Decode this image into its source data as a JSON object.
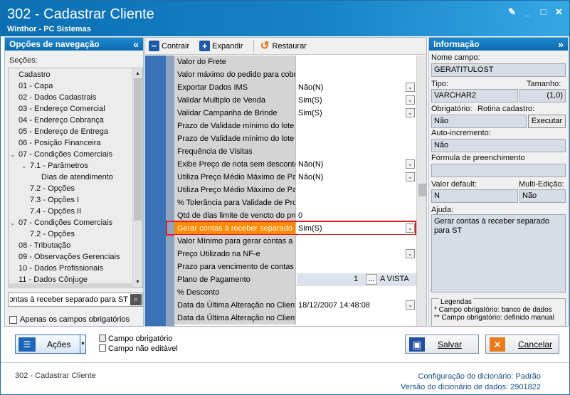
{
  "window": {
    "title": "302 - Cadastrar Cliente",
    "subtitle": "Winthor - PC Sistemas"
  },
  "nav": {
    "header": "Opções de navegação",
    "secoes_label": "Seções:",
    "items": [
      {
        "label": "Cadastro",
        "indent": 0,
        "chev": ""
      },
      {
        "label": "01 - Capa",
        "indent": 0,
        "chev": ""
      },
      {
        "label": "02 - Dados Cadastrais",
        "indent": 0,
        "chev": ""
      },
      {
        "label": "03 - Endereço Comercial",
        "indent": 0,
        "chev": ""
      },
      {
        "label": "04 - Endereço Cobrança",
        "indent": 0,
        "chev": ""
      },
      {
        "label": "05 - Endereço de Entrega",
        "indent": 0,
        "chev": ""
      },
      {
        "label": "06 - Posição Financeira",
        "indent": 0,
        "chev": ""
      },
      {
        "label": "07 - Condições Comerciais",
        "indent": 0,
        "chev": "v"
      },
      {
        "label": "7.1 - Parâmetros",
        "indent": 1,
        "chev": "v"
      },
      {
        "label": "Dias de atendimento",
        "indent": 2,
        "chev": ""
      },
      {
        "label": "7.2 - Opções",
        "indent": 1,
        "chev": ""
      },
      {
        "label": "7.3 - Opções I",
        "indent": 1,
        "chev": ""
      },
      {
        "label": "7.4 - Opções II",
        "indent": 1,
        "chev": ""
      },
      {
        "label": "07 - Condições Comerciais",
        "indent": 0,
        "chev": "v"
      },
      {
        "label": "7.2 - Opções",
        "indent": 1,
        "chev": ""
      },
      {
        "label": "08 - Tributação",
        "indent": 0,
        "chev": ""
      },
      {
        "label": "09 - Observações Gerenciais",
        "indent": 0,
        "chev": ""
      },
      {
        "label": "10 - Dados Profissionais",
        "indent": 0,
        "chev": ""
      },
      {
        "label": "11 - Dados Cônjuge",
        "indent": 0,
        "chev": ""
      }
    ],
    "search_value": "Gerar contas à receber separado para ST",
    "only_required_label": "Apenas os campos obrigatórios"
  },
  "toolbar": {
    "contrair": "Contrair",
    "expandir": "Expandir",
    "restaurar": "Restaurar"
  },
  "grid": {
    "rows": [
      {
        "label": "Valor do Frete",
        "value": "",
        "dropdown": false
      },
      {
        "label": "Valor máximo do pedido para cobrar",
        "value": "",
        "dropdown": false
      },
      {
        "label": "Exportar Dados IMS",
        "value": "Não(N)",
        "dropdown": true
      },
      {
        "label": "Validar Multiplo de Venda",
        "value": "Sim(S)",
        "dropdown": true
      },
      {
        "label": "Validar Campanha de Brinde",
        "value": "Sim(S)",
        "dropdown": true
      },
      {
        "label": "Prazo de Validade mínimo do lote / Produto",
        "value": "",
        "dropdown": false
      },
      {
        "label": "Prazo de Validade mínimo do lote / Cliente",
        "value": "",
        "dropdown": false
      },
      {
        "label": "Frequência de Visitas",
        "value": "",
        "dropdown": false
      },
      {
        "label": "Exibe Preço de nota sem desconto",
        "value": "Não(N)",
        "dropdown": true
      },
      {
        "label": "Utiliza Preço Médio Máximo de Pagamento",
        "value": "Não(N)",
        "dropdown": true
      },
      {
        "label": "Utiliza Preço Médio Máximo de Pagamento",
        "value": "",
        "dropdown": false
      },
      {
        "label": "% Tolerância para Validade de Produto",
        "value": "",
        "dropdown": false
      },
      {
        "label": "Qtd de dias limite de vencto do produto",
        "value": "0",
        "dropdown": false
      },
      {
        "label": "Gerar contas à receber separado para ST",
        "value": "Sim(S)",
        "dropdown": true,
        "selected": true
      },
      {
        "label": "Valor Mínimo para gerar contas a receber",
        "value": "",
        "dropdown": false
      },
      {
        "label": "Preço Utilizado na NF-e",
        "value": "",
        "dropdown": true
      },
      {
        "label": "Prazo para vencimento de contas a receber",
        "value": "",
        "dropdown": false
      },
      {
        "label": "Plano de Pagamento",
        "value": "1",
        "plan": true,
        "plan_btn": "...",
        "plan_desc": "A VISTA"
      },
      {
        "label": "% Desconto",
        "value": "",
        "dropdown": false
      },
      {
        "label": "Data da Última Alteração no Cliente",
        "value": "18/12/2007 14:48:08",
        "dropdown": true
      },
      {
        "label": "Data da Última Alteração no Cliente",
        "value": "",
        "dropdown": false
      }
    ]
  },
  "info": {
    "header": "Informação",
    "nome_campo_label": "Nome campo:",
    "nome_campo": "GERATITULOST",
    "tipo_label": "Tipo:",
    "tipo": "VARCHAR2",
    "tamanho_label": "Tamanho:",
    "tamanho": "(1,0)",
    "obrigatorio_label": "Obrigatório:",
    "obrigatorio": "Não",
    "rotina_label": "Rotina cadastro:",
    "executar": "Executar",
    "autoinc_label": "Auto-incremento:",
    "autoinc": "Não",
    "formula_label": "Fórmula de preenchimento",
    "formula": "",
    "default_label": "Valor default:",
    "default": "N",
    "multi_label": "Multi-Edição:",
    "multi": "Não",
    "ajuda_label": "Ajuda:",
    "ajuda": "Gerar contas à receber separado para ST",
    "legendas_label": "Legendas",
    "legenda1": "* Campo obrigatório: banco de dados",
    "legenda2": "** Campo obrigatório: definido manual"
  },
  "bottom": {
    "acoes": "Ações",
    "campo_obrigatorio": "Campo obrigatório",
    "campo_nao_editavel": "Campo não editável",
    "salvar": "Salvar",
    "cancelar": "Cancelar"
  },
  "status": {
    "rotina": "302 - Cadastrar Cliente",
    "config_label": "Configuração do dicionário:",
    "config_value": "Padrão",
    "versao_label": "Versão do dicionário de dados:",
    "versao_value": "2901822"
  }
}
